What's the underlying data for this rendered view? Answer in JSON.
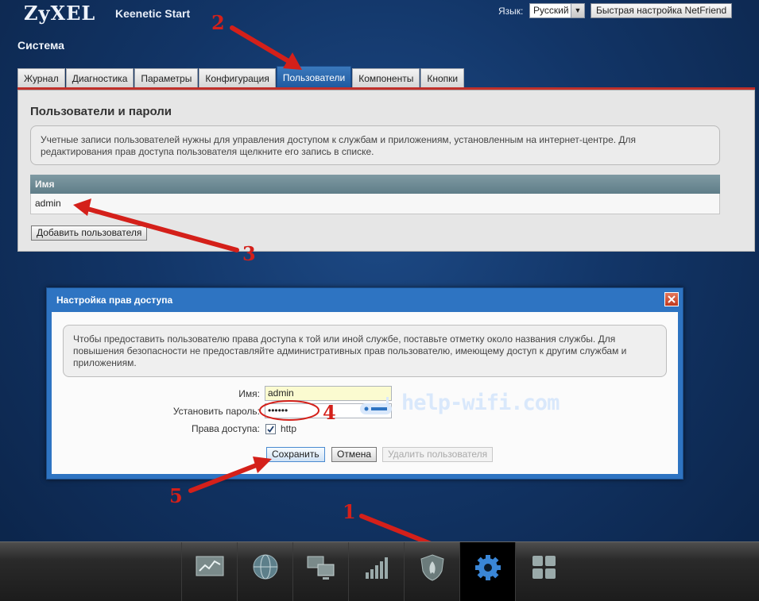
{
  "header": {
    "logo": "ZyXEL",
    "product": "Keenetic Start",
    "language_label": "Язык:",
    "language_value": "Русский",
    "quick_setup_label": "Быстрая настройка NetFriend"
  },
  "section_title": "Система",
  "tabs": [
    {
      "label": "Журнал",
      "active": false
    },
    {
      "label": "Диагностика",
      "active": false
    },
    {
      "label": "Параметры",
      "active": false
    },
    {
      "label": "Конфигурация",
      "active": false
    },
    {
      "label": "Пользователи",
      "active": true
    },
    {
      "label": "Компоненты",
      "active": false
    },
    {
      "label": "Кнопки",
      "active": false
    }
  ],
  "users_panel": {
    "title": "Пользователи и пароли",
    "info": "Учетные записи пользователей нужны для управления доступом к службам и приложениям, установленным на интернет-центре. Для редактирования прав доступа пользователя щелкните его запись в списке.",
    "column_header": "Имя",
    "rows": [
      "admin"
    ],
    "add_button": "Добавить пользователя"
  },
  "dialog": {
    "title": "Настройка прав доступа",
    "info": "Чтобы предоставить пользователю права доступа к той или иной службе, поставьте отметку около названия службы. Для повышения безопасности не предоставляйте административных прав пользователю, имеющему доступ к другим службам и приложениям.",
    "name_label": "Имя:",
    "name_value": "admin",
    "password_label": "Установить пароль:",
    "password_value": "••••••",
    "rights_label": "Права доступа:",
    "rights_checked": true,
    "rights_service": "http",
    "save_button": "Сохранить",
    "cancel_button": "Отмена",
    "delete_button": "Удалить пользователя"
  },
  "watermark": "help-wifi.com",
  "annotations": [
    "1",
    "2",
    "3",
    "4",
    "5"
  ],
  "dock": [
    {
      "icon": "monitor-chart-icon",
      "active": false
    },
    {
      "icon": "globe-icon",
      "active": false
    },
    {
      "icon": "network-computers-icon",
      "active": false
    },
    {
      "icon": "signal-bars-icon",
      "active": false
    },
    {
      "icon": "shield-icon",
      "active": false
    },
    {
      "icon": "gear-icon",
      "active": true
    },
    {
      "icon": "apps-grid-icon",
      "active": false
    }
  ],
  "colors": {
    "accent": "#2e74c2",
    "tab_underline": "#c0302a",
    "annotation_red": "#d4201a",
    "name_field_highlight": "#fbfbd0"
  }
}
